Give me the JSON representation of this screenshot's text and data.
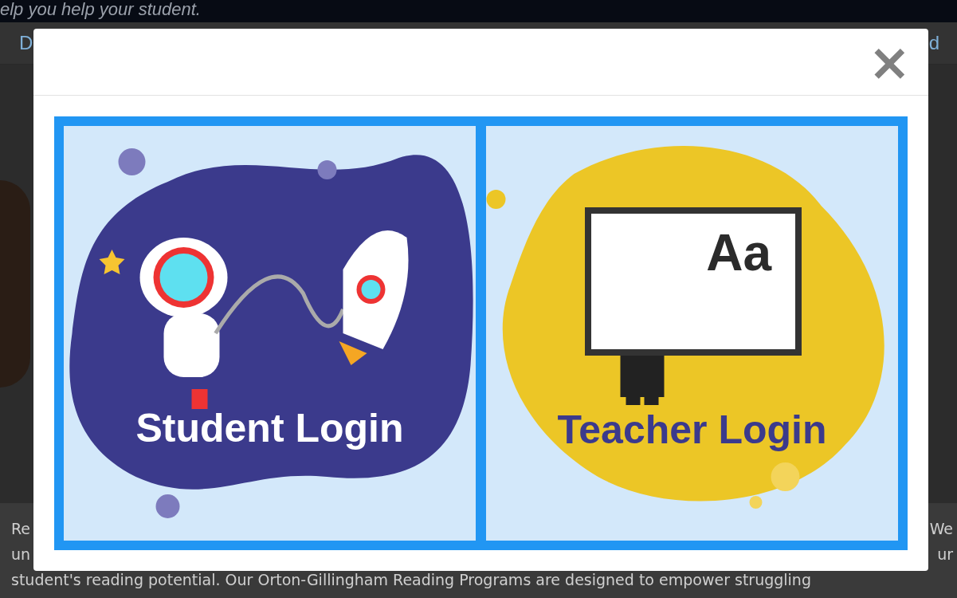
{
  "page": {
    "tagline": "elp you help your student.",
    "nav_left": "D",
    "nav_right": "d",
    "paragraph_lines": [
      {
        "left": "Re",
        "right": "We"
      },
      {
        "left": "un",
        "right": "ur"
      },
      {
        "left": "student's reading potential. Our Orton-Gillingham Reading Programs are designed to empower struggling"
      }
    ]
  },
  "modal": {
    "close": "×",
    "tiles": [
      {
        "kind": "student",
        "label": "Student Login"
      },
      {
        "kind": "teacher",
        "label": "Teacher Login",
        "board_text": "Aa"
      }
    ]
  }
}
